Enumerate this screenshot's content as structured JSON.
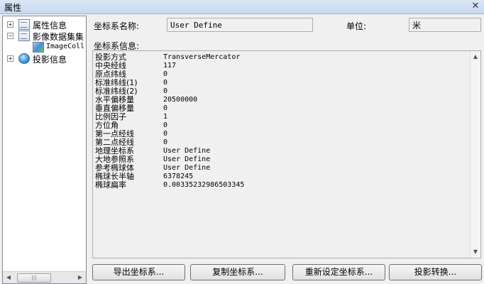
{
  "window": {
    "title": "属性",
    "close_glyph": "✕"
  },
  "tree": {
    "nodes": [
      {
        "label": "属性信息",
        "expander": "+"
      },
      {
        "label": "影像数据集集",
        "expander": "−"
      },
      {
        "label": "ImageColl"
      },
      {
        "label": "投影信息",
        "expander": "+"
      }
    ],
    "scroll_left": "◀",
    "scroll_right": "▶",
    "scroll_grip": "|||"
  },
  "coord": {
    "name_label": "坐标系名称:",
    "name_value": "User Define",
    "unit_label": "单位:",
    "unit_value": "米",
    "info_label": "坐标系信息:"
  },
  "info_rows": [
    {
      "key": "投影方式",
      "value": "TransverseMercator"
    },
    {
      "key": "中央经线",
      "value": "117"
    },
    {
      "key": "原点纬线",
      "value": "0"
    },
    {
      "key": "标准纬线(1)",
      "value": "0"
    },
    {
      "key": "标准纬线(2)",
      "value": "0"
    },
    {
      "key": "水平偏移量",
      "value": "20500000"
    },
    {
      "key": "垂直偏移量",
      "value": "0"
    },
    {
      "key": "比例因子",
      "value": "1"
    },
    {
      "key": "方位角",
      "value": "0"
    },
    {
      "key": "第一点经线",
      "value": "0"
    },
    {
      "key": "第二点经线",
      "value": "0"
    },
    {
      "key": "地理坐标系",
      "value": "User Define"
    },
    {
      "key": "大地参照系",
      "value": "User Define"
    },
    {
      "key": "参考椭球体",
      "value": "User Define"
    },
    {
      "key": "椭球长半轴",
      "value": "6378245"
    },
    {
      "key": "椭球扁率",
      "value": "0.00335232986503345"
    }
  ],
  "info_scroll": {
    "up": "▲",
    "down": "▼"
  },
  "buttons": {
    "export": "导出坐标系...",
    "copy": "复制坐标系...",
    "reset": "重新设定坐标系...",
    "convert": "投影转换..."
  }
}
